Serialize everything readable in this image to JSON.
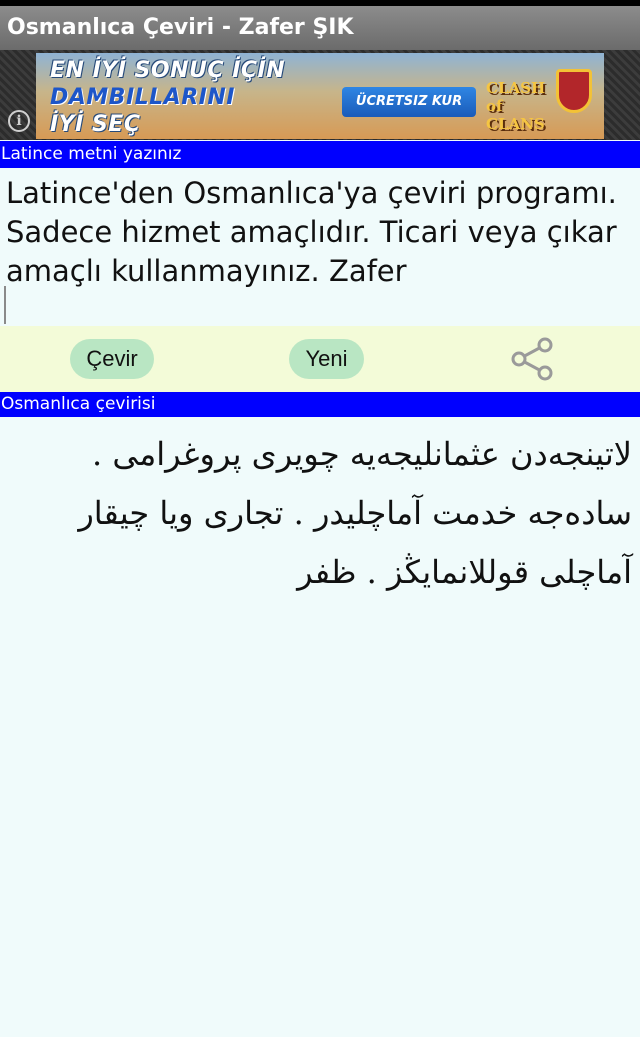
{
  "window": {
    "title": "Osmanlıca Çeviri - Zafer ŞIK"
  },
  "ad": {
    "line1": "EN İYİ SONUÇ İÇİN",
    "line2": "DAMBILLARINI",
    "line3": "İYİ SEÇ",
    "cta": "ÜCRETSIZ KUR",
    "brand": "CLASH of CLANS",
    "info_glyph": "i"
  },
  "input": {
    "header": "Latince metni yazınız",
    "value": "Latince'den Osmanlıca'ya çeviri programı. Sadece hizmet amaçlıdır. Ticari veya çıkar amaçlı kullanmayınız. Zafer"
  },
  "actions": {
    "translate_label": "Çevir",
    "new_label": "Yeni",
    "share_icon": "share-icon"
  },
  "output": {
    "header": "Osmanlıca çevirisi",
    "value": "لاتينجەدن عثمانليجەيە چويرى پروغرامى . سادەجە خدمت آماچليدر . تجارى ويا چيقار آماچلى قوللانمايڭز . ظفر"
  },
  "colors": {
    "header_bg": "#0000ff",
    "button_bg": "#b9e6c3",
    "button_bar_bg": "#f3fbd8",
    "page_bg": "#f0fbfb"
  }
}
